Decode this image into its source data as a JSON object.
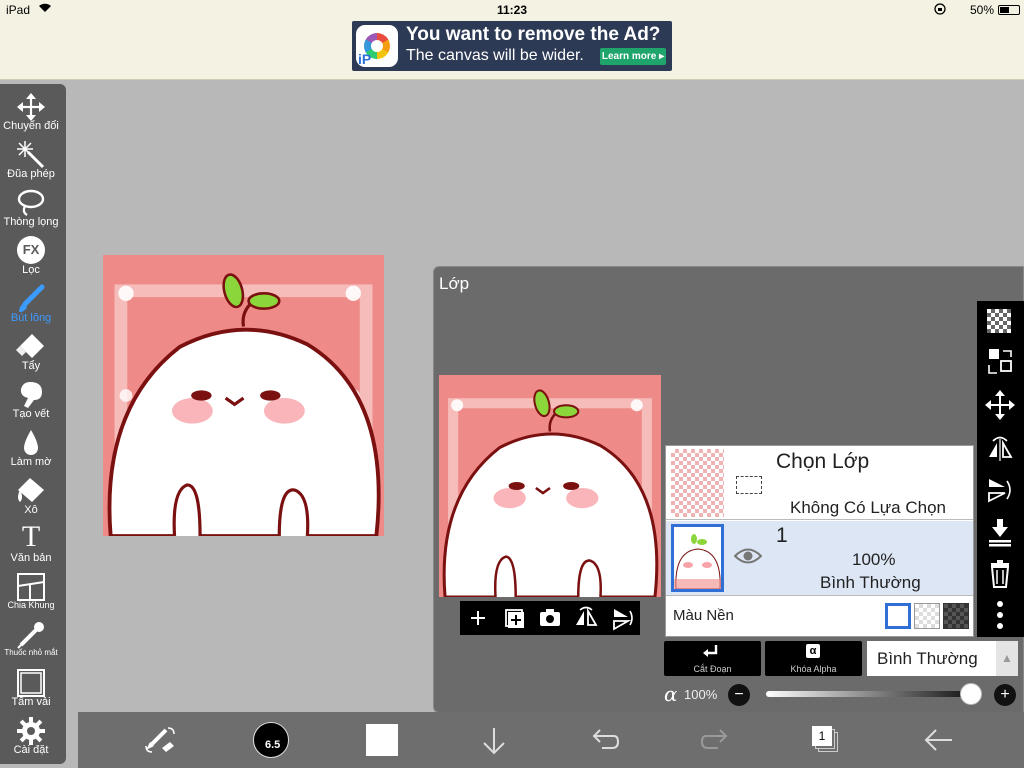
{
  "status_bar": {
    "device": "iPad",
    "time": "11:23",
    "battery": "50%"
  },
  "ad": {
    "title": "You want to remove the Ad?",
    "subtitle": "The canvas will be wider.",
    "button": "Learn more ▸",
    "logo_text": "iP"
  },
  "tools": [
    {
      "label": "Chuyển đổi",
      "icon": "move-icon"
    },
    {
      "label": "Đũa phép",
      "icon": "magic-wand-icon"
    },
    {
      "label": "Thòng lọng",
      "icon": "lasso-icon"
    },
    {
      "label": "Lọc",
      "icon": "filter-fx-icon",
      "icon_text": "FX"
    },
    {
      "label": "Bút lông",
      "icon": "brush-icon",
      "active": true
    },
    {
      "label": "Tẩy",
      "icon": "eraser-icon"
    },
    {
      "label": "Tạo vết",
      "icon": "smudge-icon"
    },
    {
      "label": "Làm mờ",
      "icon": "blur-drop-icon"
    },
    {
      "label": "Xô",
      "icon": "bucket-icon"
    },
    {
      "label": "Văn bản",
      "icon": "text-icon",
      "icon_text": "T"
    },
    {
      "label": "Chia Khung",
      "icon": "frame-divider-icon"
    },
    {
      "label": "Thuốc nhỏ mắt",
      "icon": "eyedropper-icon"
    },
    {
      "label": "Tấm vải",
      "icon": "canvas-icon"
    },
    {
      "label": "Cài đặt",
      "icon": "settings-gear-icon"
    }
  ],
  "layer_panel": {
    "title": "Lớp",
    "selection_layer": {
      "title": "Chọn Lớp",
      "status": "Không Có Lựa Chọn"
    },
    "layer1": {
      "name": "1",
      "opacity": "100%",
      "blend": "Bình Thường"
    },
    "background": {
      "label": "Màu Nền"
    },
    "clipping_label": "Cắt Đoạn",
    "alpha_lock_label": "Khóa Alpha",
    "alpha_lock_icon_text": "α",
    "blend_mode": "Bình Thường",
    "alpha_symbol": "α",
    "alpha_value": "100%",
    "opacity_value": 1.0
  },
  "bottom_bar": {
    "brush_size": "6.5",
    "layer_count": "1"
  },
  "colors": {
    "accent": "#3c9bff",
    "toolbar": "#5a5a5a",
    "panel": "#6b6b6b",
    "canvas_bg": "#ee8a88"
  }
}
